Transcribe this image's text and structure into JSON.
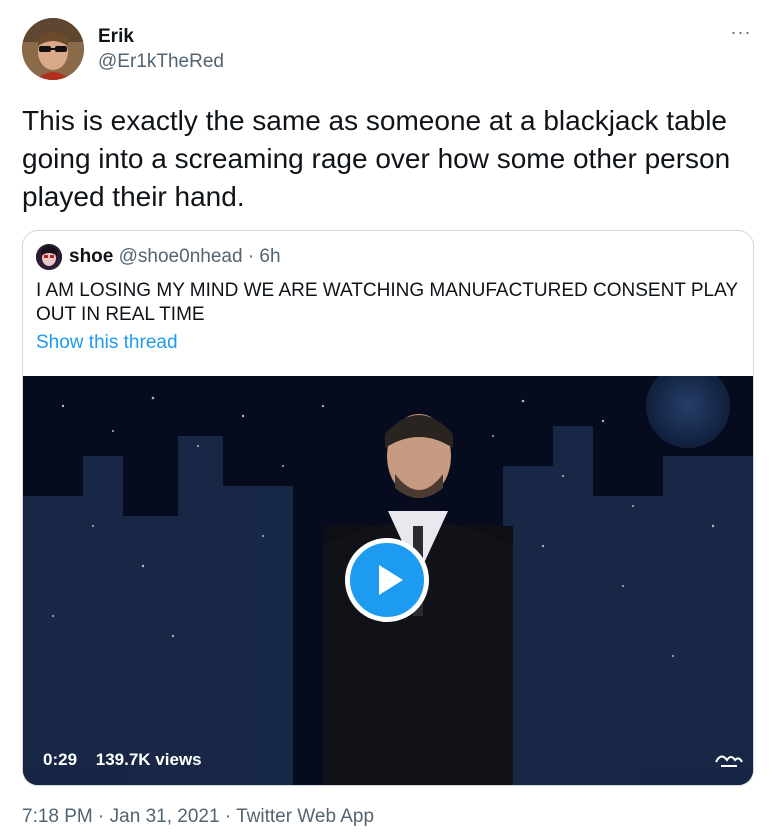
{
  "author": {
    "name": "Erik",
    "handle": "@Er1kTheRed"
  },
  "more_label": "···",
  "tweet_text": "This is exactly the same as someone at a blackjack table going into a screaming rage over how some other person played their hand.",
  "quoted": {
    "name": "shoe",
    "handle": "@shoe0nhead",
    "separator": "·",
    "time": "6h",
    "text": "I AM LOSING MY MIND WE ARE WATCHING MANUFACTURED CONSENT PLAY OUT IN REAL TIME",
    "thread_link": "Show this thread",
    "video": {
      "duration": "0:29",
      "views": "139.7K views"
    }
  },
  "footer": {
    "time": "7:18 PM",
    "sep1": " · ",
    "date": "Jan 31, 2021",
    "sep2": " · ",
    "source": "Twitter Web App"
  },
  "colors": {
    "accent": "#1d9bf0",
    "secondary_text": "#536471",
    "border": "#cfd9de"
  }
}
